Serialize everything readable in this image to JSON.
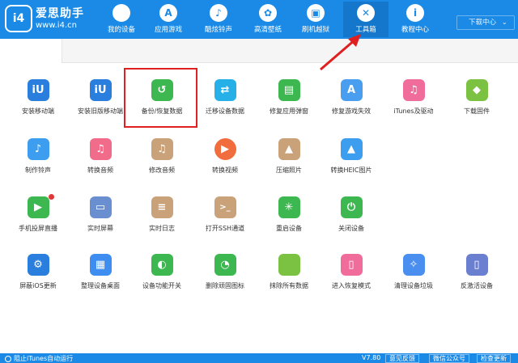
{
  "header": {
    "logo": "i4",
    "brand_title": "爱思助手",
    "brand_url": "www.i4.cn",
    "nav": [
      {
        "label": "我的设备",
        "icon": "apple-icon",
        "glyph": ""
      },
      {
        "label": "应用游戏",
        "icon": "app-store-icon",
        "glyph": "A"
      },
      {
        "label": "酷炫铃声",
        "icon": "bell-icon",
        "glyph": "♪"
      },
      {
        "label": "高清壁纸",
        "icon": "flower-icon",
        "glyph": "✿"
      },
      {
        "label": "刷机越狱",
        "icon": "box-icon",
        "glyph": "▣"
      },
      {
        "label": "工具箱",
        "icon": "tools-icon",
        "glyph": "✕"
      },
      {
        "label": "教程中心",
        "icon": "info-icon",
        "glyph": "i"
      }
    ],
    "download_label": "下载中心"
  },
  "tools": [
    {
      "label": "安装移动端",
      "icon": "i4-mobile-icon",
      "glyph": "iU",
      "color": "#2a7fde"
    },
    {
      "label": "安装旧版移动端",
      "icon": "i4-legacy-icon",
      "glyph": "iU",
      "color": "#2a7fde"
    },
    {
      "label": "备份/恢复数据",
      "icon": "backup-restore-icon",
      "glyph": "↺",
      "color": "#3db74f"
    },
    {
      "label": "迁移设备数据",
      "icon": "migrate-icon",
      "glyph": "⇄",
      "color": "#27b0e8"
    },
    {
      "label": "修复应用弹窗",
      "icon": "repair-popup-icon",
      "glyph": "▤",
      "color": "#3db74f"
    },
    {
      "label": "修复游戏失效",
      "icon": "repair-game-icon",
      "glyph": "A",
      "color": "#4a9ef0"
    },
    {
      "label": "iTunes及驱动",
      "icon": "itunes-icon",
      "glyph": "♫",
      "color": "#f06c9b"
    },
    {
      "label": "下载固件",
      "icon": "firmware-icon",
      "glyph": "◆",
      "color": "#7cc242"
    },
    {
      "label": "制作铃声",
      "icon": "bell-icon",
      "glyph": "♪",
      "color": "#3d9ef0"
    },
    {
      "label": "转换音频",
      "icon": "audio-convert-icon",
      "glyph": "♫",
      "color": "#f06c8a"
    },
    {
      "label": "修改音频",
      "icon": "audio-edit-icon",
      "glyph": "♫",
      "color": "#c9a27a"
    },
    {
      "label": "转换视频",
      "icon": "video-convert-icon",
      "glyph": "▶",
      "color": "#f26d3d"
    },
    {
      "label": "压缩照片",
      "icon": "photo-compress-icon",
      "glyph": "▲",
      "color": "#c9a27a"
    },
    {
      "label": "转换HEIC图片",
      "icon": "heic-icon",
      "glyph": "▲",
      "color": "#3d9ef0"
    },
    {
      "label": "手机投屏直播",
      "icon": "screen-mirror-icon",
      "glyph": "▶",
      "color": "#3db74f"
    },
    {
      "label": "实时屏幕",
      "icon": "monitor-icon",
      "glyph": "▭",
      "color": "#6a8fd0"
    },
    {
      "label": "实时日志",
      "icon": "log-icon",
      "glyph": "≡",
      "color": "#c9a27a"
    },
    {
      "label": "打开SSH通道",
      "icon": "terminal-icon",
      "glyph": ">_",
      "color": "#c9a27a"
    },
    {
      "label": "重启设备",
      "icon": "restart-icon",
      "glyph": "✳",
      "color": "#3db74f"
    },
    {
      "label": "关闭设备",
      "icon": "power-icon",
      "glyph": "⏻",
      "color": "#3db74f"
    },
    {
      "label": "屏蔽iOS更新",
      "icon": "block-update-icon",
      "glyph": "⚙",
      "color": "#2a7fde"
    },
    {
      "label": "整理设备桌面",
      "icon": "desktop-grid-icon",
      "glyph": "▦",
      "color": "#3d8ef0"
    },
    {
      "label": "设备功能开关",
      "icon": "toggle-icon",
      "glyph": "◐",
      "color": "#3db74f"
    },
    {
      "label": "删除顽固图标",
      "icon": "delete-icon-icon",
      "glyph": "◔",
      "color": "#3db74f"
    },
    {
      "label": "抹除所有数据",
      "icon": "erase-icon",
      "glyph": "",
      "color": "#7cc242"
    },
    {
      "label": "进入恢复模式",
      "icon": "recovery-icon",
      "glyph": "▯",
      "color": "#f06c9b"
    },
    {
      "label": "清理设备垃圾",
      "icon": "broom-icon",
      "glyph": "✧",
      "color": "#4a8ef0"
    },
    {
      "label": "反激活设备",
      "icon": "deactivate-icon",
      "glyph": "▯",
      "color": "#6a7fd0"
    }
  ],
  "footer": {
    "itunes_label": "阻止iTunes自动运行",
    "version": "V7.80",
    "feedback": "意见反馈",
    "wechat": "微信公众号",
    "update": "检查更新"
  },
  "colors": {
    "brand": "#1a8ae6",
    "highlight": "#e02020"
  }
}
